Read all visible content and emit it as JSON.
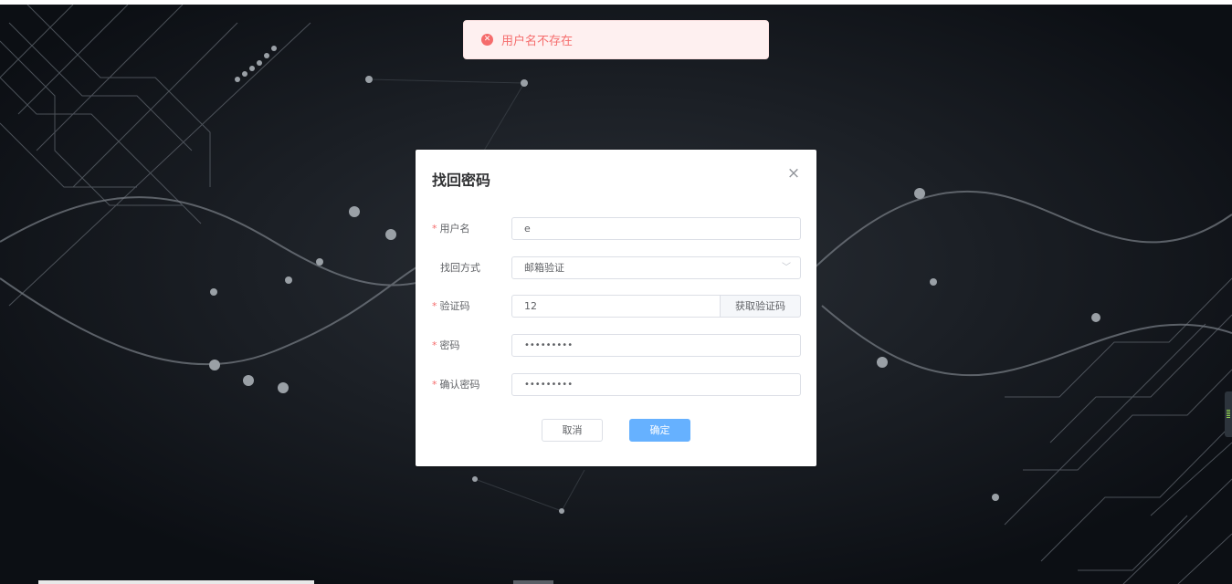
{
  "toast": {
    "message": "用户名不存在",
    "icon": "error-circle-icon",
    "color": "#f56c6c"
  },
  "dialog": {
    "title": "找回密码",
    "close_icon": "close-icon",
    "fields": {
      "username": {
        "label": "用户名",
        "required": "*",
        "value": "e"
      },
      "method": {
        "label": "找回方式",
        "value": "邮箱验证"
      },
      "code": {
        "label": "验证码",
        "required": "*",
        "value": "12",
        "button": "获取验证码"
      },
      "password": {
        "label": "密码",
        "required": "*",
        "value": "•••••••••"
      },
      "confirm": {
        "label": "确认密码",
        "required": "*",
        "value": "•••••••••"
      }
    },
    "cancel_label": "取消",
    "confirm_label": "确定"
  },
  "colors": {
    "primary": "#66b1ff",
    "danger": "#f56c6c",
    "background": "#0d1117"
  }
}
